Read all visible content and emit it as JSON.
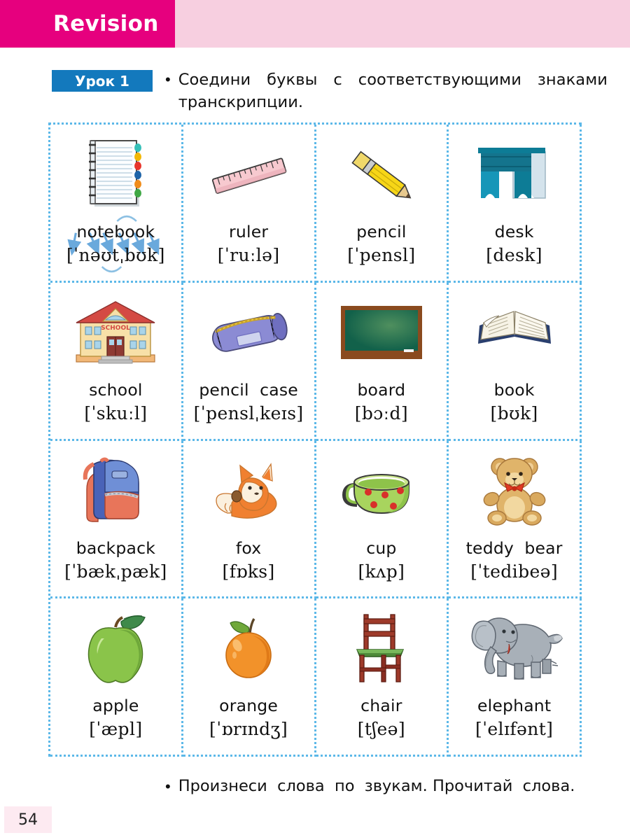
{
  "header": {
    "title": "Revision",
    "band_color": "#f7cfe0",
    "block_color": "#e6007e"
  },
  "task": {
    "lesson_badge": "Урок 1",
    "badge_color": "#1379bd",
    "bullet": "•",
    "instruction": "Соедини буквы с соответствующими знаками транскрипции."
  },
  "grid": {
    "border_color": "#5cb8e8",
    "columns": 4,
    "rows": 4,
    "cells": [
      {
        "icon": "notebook-icon",
        "word": "notebook",
        "ipa": "[ˈnəʊtˌbʊk]",
        "annotated": true
      },
      {
        "icon": "ruler-icon",
        "word": "ruler",
        "ipa": "[ˈruːlə]",
        "annotated": false
      },
      {
        "icon": "pencil-icon",
        "word": "pencil",
        "ipa": "[ˈpensl]",
        "annotated": false
      },
      {
        "icon": "desk-icon",
        "word": "desk",
        "ipa": "[desk]",
        "annotated": false
      },
      {
        "icon": "school-icon",
        "word": "school",
        "ipa": "[ˈskuːl]",
        "annotated": false
      },
      {
        "icon": "pencil-case-icon",
        "word": "pencil  case",
        "ipa": "[ˈpenslˌkeɪs]",
        "annotated": false
      },
      {
        "icon": "board-icon",
        "word": "board",
        "ipa": "[bɔːd]",
        "annotated": false
      },
      {
        "icon": "book-icon",
        "word": "book",
        "ipa": "[bʊk]",
        "annotated": false
      },
      {
        "icon": "backpack-icon",
        "word": "backpack",
        "ipa": "[ˈbækˌpæk]",
        "annotated": false
      },
      {
        "icon": "fox-icon",
        "word": "fox",
        "ipa": "[fɒks]",
        "annotated": false
      },
      {
        "icon": "cup-icon",
        "word": "cup",
        "ipa": "[kʌp]",
        "annotated": false
      },
      {
        "icon": "teddy-bear-icon",
        "word": "teddy  bear",
        "ipa": "[ˈtedibeə]",
        "annotated": false
      },
      {
        "icon": "apple-icon",
        "word": "apple",
        "ipa": "[ˈæpl]",
        "annotated": false
      },
      {
        "icon": "orange-icon",
        "word": "orange",
        "ipa": "[ˈɒrɪndʒ]",
        "annotated": false
      },
      {
        "icon": "chair-icon",
        "word": "chair",
        "ipa": "[tʃeə]",
        "annotated": false
      },
      {
        "icon": "elephant-icon",
        "word": "elephant",
        "ipa": "[ˈelɪfənt]",
        "annotated": false
      }
    ]
  },
  "footer": {
    "bullet": "•",
    "text": "Произнеси  слова  по  звукам. Прочитай  слова.",
    "page_number": "54",
    "page_block_color": "#fdeaf1"
  }
}
